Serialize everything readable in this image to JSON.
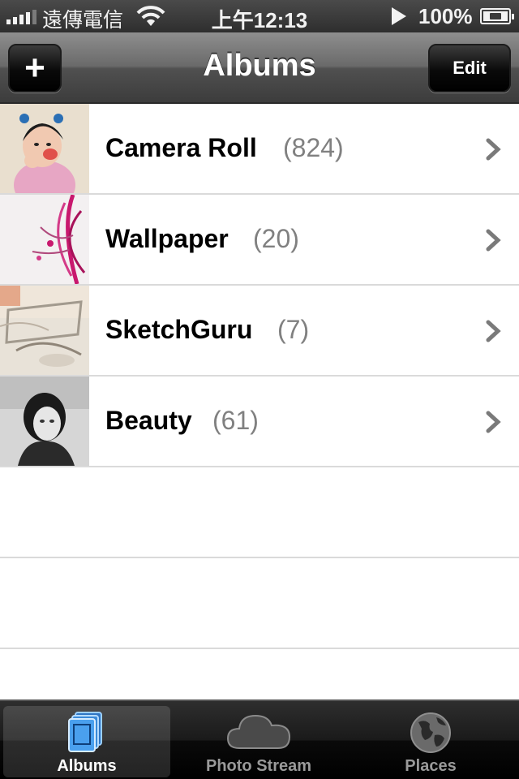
{
  "status_bar": {
    "carrier": "遠傳電信",
    "time": "上午12:13",
    "battery": "100%"
  },
  "nav": {
    "title": "Albums",
    "add_label": "+",
    "edit_label": "Edit"
  },
  "albums": [
    {
      "name": "Camera Roll",
      "count": "(824)"
    },
    {
      "name": "Wallpaper",
      "count": "(20)"
    },
    {
      "name": "SketchGuru",
      "count": "(7)"
    },
    {
      "name": "Beauty",
      "count": "(61)"
    }
  ],
  "tabs": [
    {
      "label": "Albums",
      "icon": "albums-icon",
      "selected": true
    },
    {
      "label": "Photo Stream",
      "icon": "cloud-icon",
      "selected": false
    },
    {
      "label": "Places",
      "icon": "globe-icon",
      "selected": false
    }
  ],
  "colors": {
    "nav_bar": "#6a6a6a",
    "count_text": "#808080",
    "tab_selected_icon": "#5aa9f0"
  }
}
